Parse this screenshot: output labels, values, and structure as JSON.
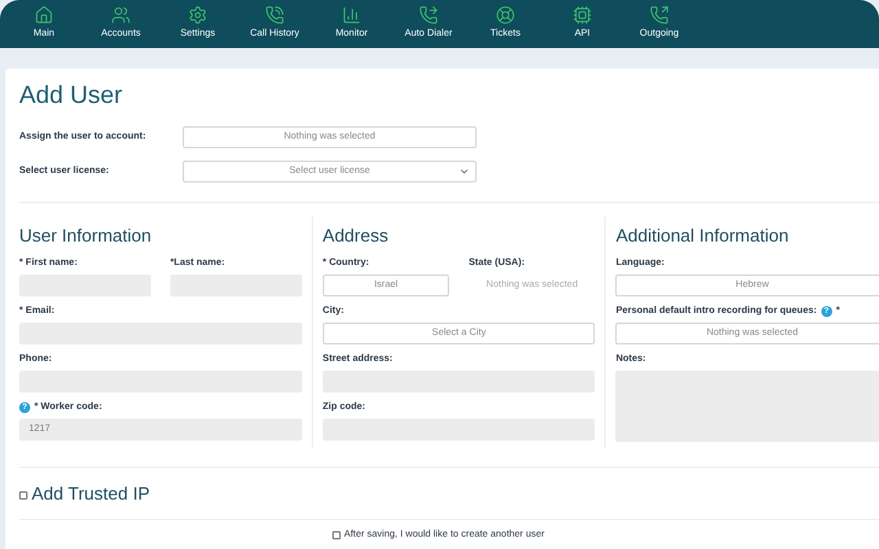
{
  "nav": [
    {
      "label": "Main"
    },
    {
      "label": "Accounts"
    },
    {
      "label": "Settings"
    },
    {
      "label": "Call History"
    },
    {
      "label": "Monitor"
    },
    {
      "label": "Auto Dialer"
    },
    {
      "label": "Tickets"
    },
    {
      "label": "API"
    },
    {
      "label": "Outgoing"
    }
  ],
  "page_title": "Add User",
  "top_fields": [
    {
      "label": "Assign the user to account:",
      "value": "Nothing was selected",
      "caret": false
    },
    {
      "label": "Select user license:",
      "value": "Select user license",
      "caret": true
    }
  ],
  "sections": [
    {
      "title": "User Information",
      "rows": [
        [
          {
            "label": "* First name:",
            "kind": "input"
          },
          {
            "label": "*Last name:",
            "kind": "input"
          }
        ],
        [
          {
            "label": "* Email:",
            "kind": "input"
          }
        ],
        [
          {
            "label": "Phone:",
            "kind": "input"
          }
        ],
        [
          {
            "label": "* Worker code:",
            "kind": "input",
            "help": "?",
            "help_after_label": false,
            "value": "1217"
          }
        ]
      ]
    },
    {
      "title": "Address",
      "rows": [
        [
          {
            "label": "* Country:",
            "kind": "select",
            "value": "Israel"
          },
          {
            "label": "State (USA):",
            "kind": "text",
            "value": "Nothing was selected"
          }
        ],
        [
          {
            "label": "City:",
            "kind": "select",
            "value": "Select a City"
          }
        ],
        [
          {
            "label": "Street address:",
            "kind": "input"
          }
        ],
        [
          {
            "label": "Zip code:",
            "kind": "input"
          }
        ]
      ]
    },
    {
      "title": "Additional Information",
      "rows": [
        [
          {
            "label": "Language:",
            "kind": "select",
            "value": "Hebrew"
          }
        ],
        [
          {
            "label": "Personal default intro recording for queues:",
            "kind": "select",
            "help": "?",
            "help_after_label": true,
            "suffix": "*",
            "value": "Nothing was selected"
          }
        ],
        [
          {
            "label": "Notes:",
            "kind": "textarea"
          }
        ]
      ]
    }
  ],
  "trusted_ip": {
    "label": "Add Trusted IP",
    "checked": false
  },
  "create_another": {
    "label": "After saving, I would like to create another user",
    "checked": false
  }
}
